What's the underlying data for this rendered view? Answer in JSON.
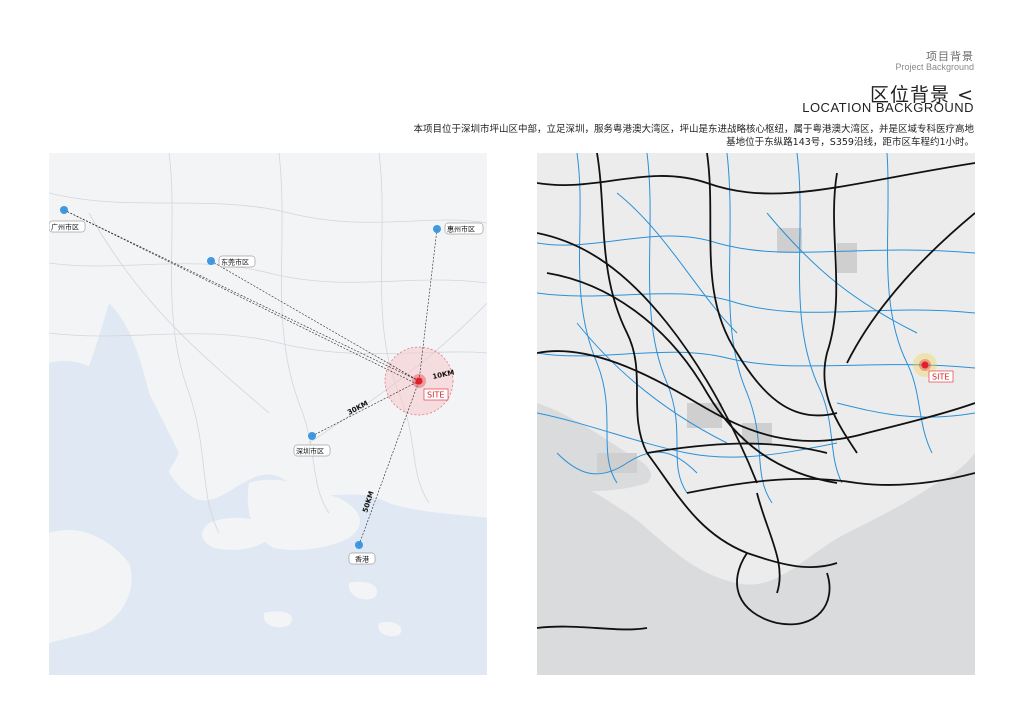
{
  "header": {
    "section_cn": "项目背景",
    "section_en": "Project Background",
    "title_cn": "区位背景 <",
    "title_en": "LOCATION BACKGROUND",
    "description_line1": "本项目位于深圳市坪山区中部，立足深圳，服务粤港澳大湾区，坪山是东进战略核心枢纽，属于粤港澳大湾区，并是区域专科医疗高地",
    "description_line2": "基地位于东纵路143号，S359沿线，距市区车程约1小时。"
  },
  "left_map": {
    "cities": [
      "广州市区",
      "东莞市区",
      "惠州市区",
      "深圳市区",
      "香港"
    ],
    "site_label": "SITE",
    "distances": [
      "10KM",
      "30KM",
      "50KM"
    ]
  },
  "right_map": {
    "site_label": "SITE"
  },
  "colors": {
    "site": "#e0202a",
    "city_marker": "#2c8fe0",
    "road_blue": "#2a90d8",
    "rail_black": "#111111",
    "water": "#dfe8f3"
  }
}
